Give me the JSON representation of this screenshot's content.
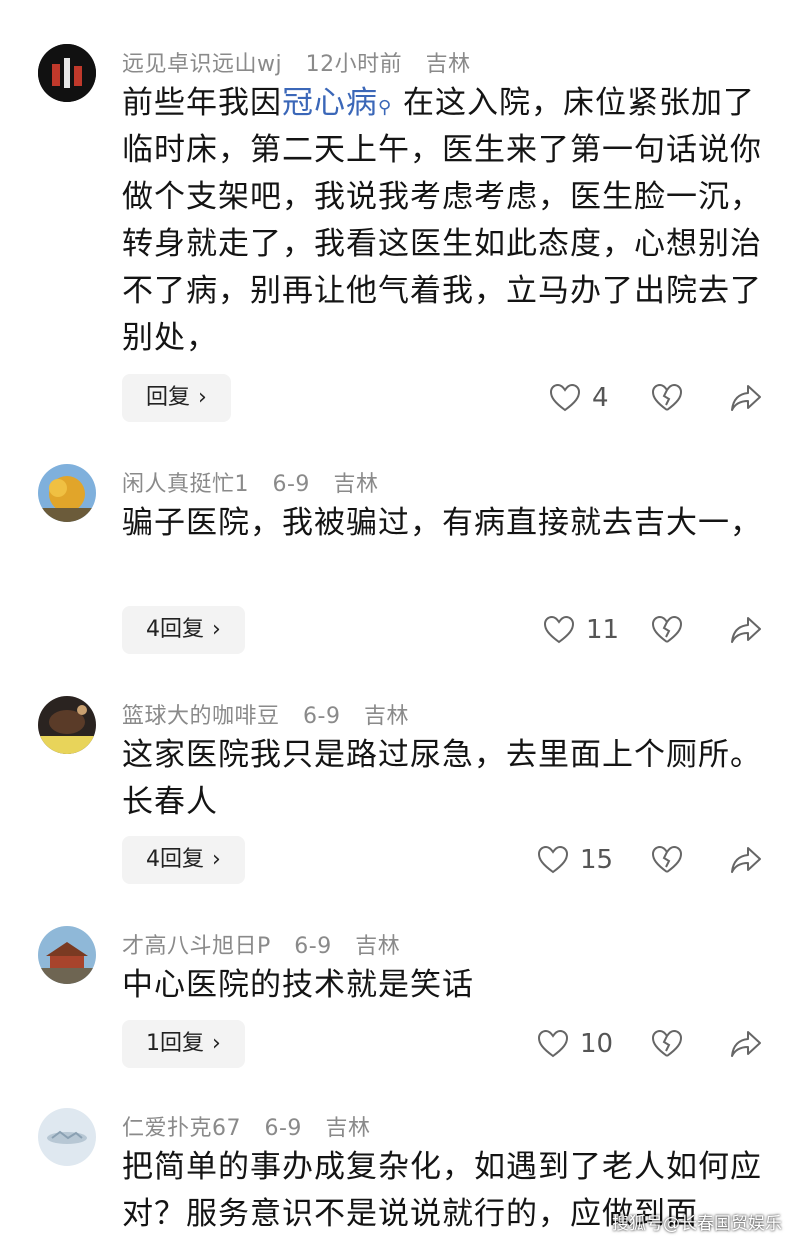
{
  "comments": [
    {
      "user": "远见卓识远山wj",
      "time": "12小时前",
      "location": "吉林",
      "text_before": "前些年我因",
      "text_link": "冠心病",
      "text_after": " 在这入院，床位紧张加了临时床，第二天上午，医生来了第一句话说你做个支架吧，我说我考虑考虑，医生脸一沉，转身就走了，我看这医生如此态度，心想别治不了病，别再让他气着我，立马办了出院去了别处，",
      "reply_label": "回复",
      "likes": "4"
    },
    {
      "user": "闲人真挺忙1",
      "time": "6-9",
      "location": "吉林",
      "text": "骗子医院，我被骗过，有病直接就去吉大一，",
      "reply_label": "4回复",
      "likes": "11"
    },
    {
      "user": "篮球大的咖啡豆",
      "time": "6-9",
      "location": "吉林",
      "text": "这家医院我只是路过尿急，去里面上个厕所。长春人",
      "reply_label": "4回复",
      "likes": "15"
    },
    {
      "user": "才高八斗旭日P",
      "time": "6-9",
      "location": "吉林",
      "text": "中心医院的技术就是笑话",
      "reply_label": "1回复",
      "likes": "10"
    },
    {
      "user": "仁爱扑克67",
      "time": "6-9",
      "location": "吉林",
      "text": "把简单的事办成复杂化，如遇到了老人如何应对？服务意识不是说说就行的，应做到面"
    }
  ],
  "watermark": "搜狐号@长春国贸娱乐",
  "icons": {
    "like": "heart-icon",
    "dislike": "broken-heart-icon",
    "share": "share-arrow-icon",
    "chevron": "chevron-right-icon",
    "search": "search-icon"
  },
  "colors": {
    "link": "#3b67b8",
    "meta": "#8a8a8a",
    "reply_bg": "#f3f3f3"
  }
}
